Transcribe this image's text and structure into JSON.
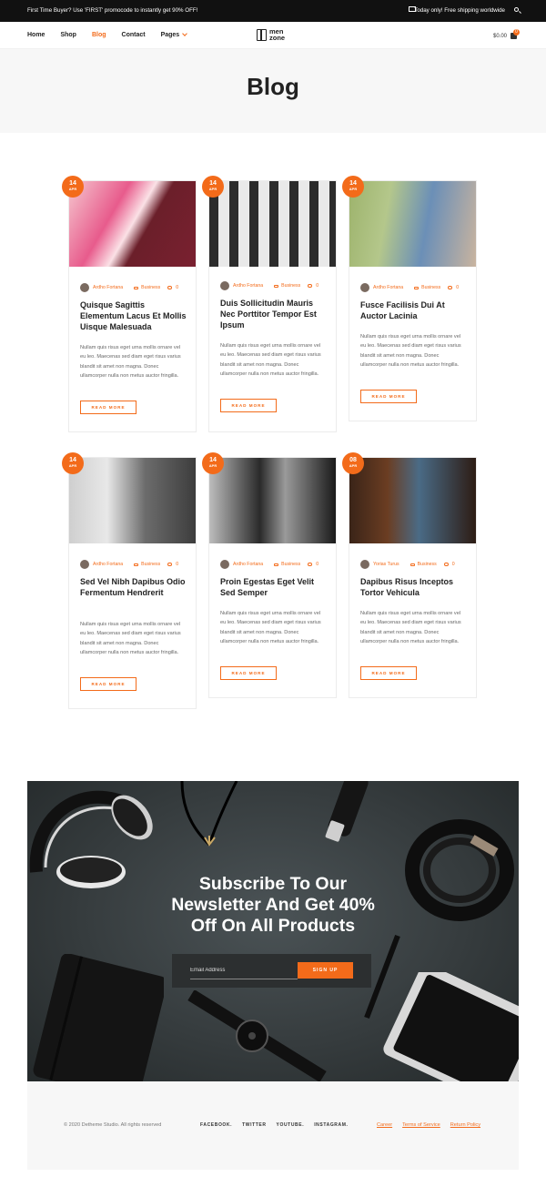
{
  "topbar": {
    "promo": "First Time Buyer? Use 'FIRST' promocode to instantly get 90% OFF!",
    "shipping": "Today only! Free shipping worldwide"
  },
  "nav": {
    "items": [
      "Home",
      "Shop",
      "Blog",
      "Contact",
      "Pages"
    ],
    "active": "Blog",
    "logo_line1": "men",
    "logo_line2": "zone",
    "cart_total": "$0.00",
    "cart_count": "0"
  },
  "hero": {
    "title": "Blog"
  },
  "posts": [
    {
      "day": "14",
      "month": "APR",
      "author": "Ardho Fortana",
      "category": "Business",
      "comments": "0",
      "title": "Quisque Sagittis Elementum Lacus Et Mollis Uisque Malesuada",
      "excerpt": "Nullam quis risus eget urna mollis ornare vel eu leo. Maecenas sed diam eget risus varius blandit sit amet non magna. Donec ullamcorper nulla non metus auctor fringilla.",
      "read_more": "READ MORE"
    },
    {
      "day": "14",
      "month": "APR",
      "author": "Ardho Fortana",
      "category": "Business",
      "comments": "0",
      "title": "Duis Sollicitudin Mauris Nec Porttitor Tempor Est Ipsum",
      "excerpt": "Nullam quis risus eget urna mollis ornare vel eu leo. Maecenas sed diam eget risus varius blandit sit amet non magna. Donec ullamcorper nulla non metus auctor fringilla.",
      "read_more": "READ MORE"
    },
    {
      "day": "14",
      "month": "APR",
      "author": "Ardho Fortana",
      "category": "Business",
      "comments": "0",
      "title": "Fusce Facilisis Dui At Auctor Lacinia",
      "excerpt": "Nullam quis risus eget urna mollis ornare vel eu leo. Maecenas sed diam eget risus varius blandit sit amet non magna. Donec ullamcorper nulla non metus auctor fringilla.",
      "read_more": "READ MORE"
    },
    {
      "day": "14",
      "month": "APR",
      "author": "Ardho Fortana",
      "category": "Business",
      "comments": "0",
      "title": "Sed Vel Nibh Dapibus Odio Fermentum Hendrerit",
      "excerpt": "Nullam quis risus eget urna mollis ornare vel eu leo. Maecenas sed diam eget risus varius blandit sit amet non magna. Donec ullamcorper nulla non metus auctor fringilla.",
      "read_more": "READ MORE"
    },
    {
      "day": "14",
      "month": "APR",
      "author": "Ardho Fortana",
      "category": "Business",
      "comments": "0",
      "title": "Proin Egestas Eget Velit Sed Semper",
      "excerpt": "Nullam quis risus eget urna mollis ornare vel eu leo. Maecenas sed diam eget risus varius blandit sit amet non magna. Donec ullamcorper nulla non metus auctor fringilla.",
      "read_more": "READ MORE"
    },
    {
      "day": "08",
      "month": "APR",
      "author": "Yorias Turus",
      "category": "Business",
      "comments": "0",
      "title": "Dapibus Risus Inceptos Tortor Vehicula",
      "excerpt": "Nullam quis risus eget urna mollis ornare vel eu leo. Maecenas sed diam eget risus varius blandit sit amet non magna. Donec ullamcorper nulla non metus auctor fringilla.",
      "read_more": "READ MORE"
    }
  ],
  "newsletter": {
    "heading_line1": "Subscribe To Our",
    "heading_line2": "Newsletter And Get 40%",
    "heading_line3": "Off On All Products",
    "email_placeholder": "Email Address",
    "button": "SIGN UP"
  },
  "footer": {
    "copyright": "© 2020 Dethemе Studio. All rights reserved",
    "social": [
      "FACEBOOK.",
      "TWITTER",
      "YOUTUBE.",
      "INSTAGRAM."
    ],
    "links": [
      "Career",
      "Terms of Service",
      "Return Policy"
    ]
  },
  "colors": {
    "accent": "#f36b1a",
    "topbar": "#111111",
    "hero_bg": "#f7f7f7"
  }
}
